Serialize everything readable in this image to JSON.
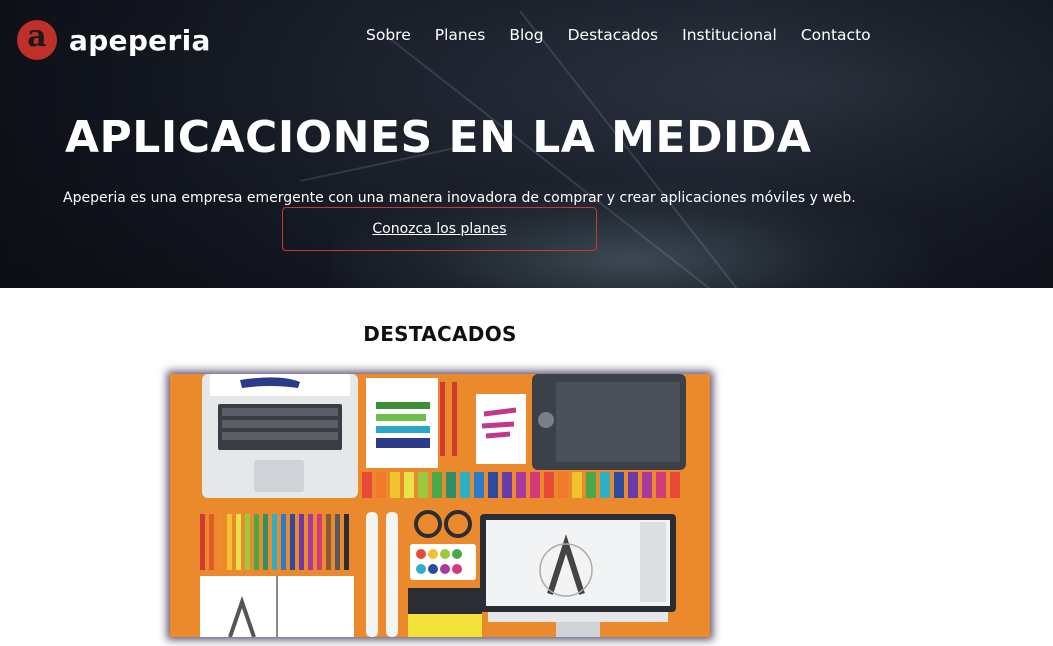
{
  "header": {
    "logo_letter": "a",
    "logo_text": "apeperia",
    "nav": [
      "Sobre",
      "Planes",
      "Blog",
      "Destacados",
      "Institucional",
      "Contacto"
    ]
  },
  "hero": {
    "title": "APLICACIONES EN LA MEDIDA",
    "subtitle": "Apeperia es una empresa emergente con una manera inovadora de comprar y crear aplicaciones móviles y web.",
    "cta_label": "Conozca los planes"
  },
  "featured": {
    "heading": "DESTACADOS",
    "image_icon": "designer-workspace-illustration"
  },
  "colors": {
    "accent": "#c0302a",
    "hero_bg": "#1a1f2a",
    "illustration_bg": "#ea8a2c"
  }
}
